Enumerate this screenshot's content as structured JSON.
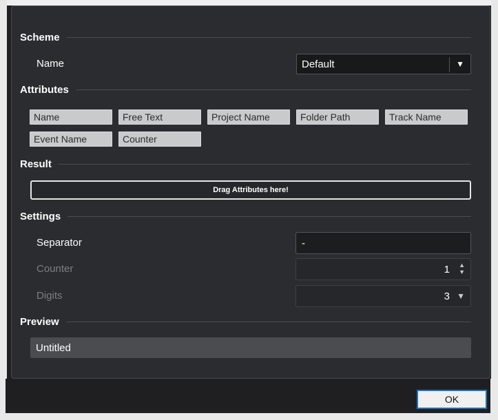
{
  "scheme": {
    "header": "Scheme",
    "name_label": "Name",
    "name_value": "Default"
  },
  "attributes": {
    "header": "Attributes",
    "items": [
      "Name",
      "Free Text",
      "Project Name",
      "Folder Path",
      "Track Name",
      "Event Name",
      "Counter"
    ]
  },
  "result": {
    "header": "Result",
    "dropzone_text": "Drag Attributes here!"
  },
  "settings": {
    "header": "Settings",
    "separator_label": "Separator",
    "separator_value": "-",
    "counter_label": "Counter",
    "counter_value": "1",
    "digits_label": "Digits",
    "digits_value": "3"
  },
  "preview": {
    "header": "Preview",
    "value": "Untitled"
  },
  "footer": {
    "ok_label": "OK"
  }
}
